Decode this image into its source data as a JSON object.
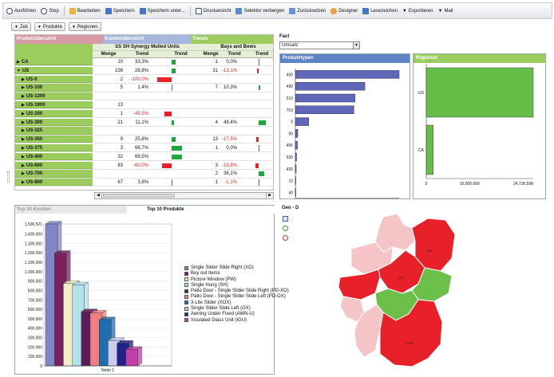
{
  "toolbar": {
    "run": "Ausführen",
    "stop": "Stop",
    "edit": "Bearbeiten",
    "save": "Speichern",
    "save_as": "Speichern unter...",
    "print": "Druckansicht",
    "hide_selector": "Selektor verbergen",
    "reset": "Zurücksetzen",
    "designer": "Designer",
    "bookmarks": "Lesezeichen",
    "export": "Exportieren",
    "mail": "Mail"
  },
  "dims": {
    "time": "Zeit",
    "products": "Produkte",
    "regions": "Regionen"
  },
  "grid": {
    "h_products": "Produktübersicht",
    "h_customers": "Kundenübersicht",
    "h_trends": "Trends",
    "g1": "SS SH Synergy Mulled Units",
    "g2": "Bays and Bows",
    "col_qty": "Menge",
    "col_trend": "Trend",
    "col_trend2": "Trend",
    "col_qty2": "Menge",
    "col_trend3": "Trend",
    "col_trend4": "Trend",
    "rows": [
      {
        "label": "CA",
        "lvl": 0,
        "arrow": "▶",
        "m1": "10",
        "t1": "33,3%",
        "b1": {
          "c": "g",
          "w": 5
        },
        "m2": "1",
        "t2": "0,0%",
        "b2": {
          "c": "t",
          "w": 1
        }
      },
      {
        "label": "US",
        "lvl": 0,
        "arrow": "▼",
        "m1": "236",
        "t1": "28,8%",
        "b1": {
          "c": "g",
          "w": 5
        },
        "m2": "31",
        "t2": "-13,1%",
        "b2": {
          "c": "r",
          "w": 2
        }
      },
      {
        "label": "US-0",
        "lvl": 1,
        "arrow": "▶",
        "m1": "2",
        "t1": "-100,0%",
        "b1": {
          "c": "r",
          "w": 18
        },
        "m2": "",
        "t2": "",
        "b2": null
      },
      {
        "label": "US-100",
        "lvl": 1,
        "arrow": "▶",
        "m1": "5",
        "t1": "1,4%",
        "b1": {
          "c": "t",
          "w": 1
        },
        "m2": "7",
        "t2": "10,3%",
        "b2": {
          "c": "g",
          "w": 2
        }
      },
      {
        "label": "US-1300",
        "lvl": 1,
        "arrow": "▶",
        "m1": "",
        "t1": "",
        "b1": null,
        "m2": "",
        "t2": "",
        "b2": null
      },
      {
        "label": "US-1900",
        "lvl": 1,
        "arrow": "▶",
        "m1": "13",
        "t1": "",
        "b1": null,
        "m2": "",
        "t2": "",
        "b2": null
      },
      {
        "label": "US-200",
        "lvl": 1,
        "arrow": "▶",
        "m1": "1",
        "t1": "-45,5%",
        "b1": {
          "c": "r",
          "w": 9
        },
        "m2": "",
        "t2": "",
        "b2": null
      },
      {
        "label": "US-300",
        "lvl": 1,
        "arrow": "▶",
        "m1": "21",
        "t1": "11,1%",
        "b1": {
          "c": "g",
          "w": 3
        },
        "m2": "4",
        "t2": "48,4%",
        "b2": {
          "c": "g",
          "w": 9
        }
      },
      {
        "label": "US-325",
        "lvl": 1,
        "arrow": "▶",
        "m1": "",
        "t1": "",
        "b1": null,
        "m2": "",
        "t2": "",
        "b2": null
      },
      {
        "label": "US-350",
        "lvl": 1,
        "arrow": "▶",
        "m1": "9",
        "t1": "25,8%",
        "b1": {
          "c": "g",
          "w": 5
        },
        "m2": "13",
        "t2": "-17,5%",
        "b2": {
          "c": "r",
          "w": 3
        }
      },
      {
        "label": "US-375",
        "lvl": 1,
        "arrow": "▶",
        "m1": "3",
        "t1": "66,7%",
        "b1": {
          "c": "g",
          "w": 13
        },
        "m2": "1",
        "t2": "0,0%",
        "b2": {
          "c": "t",
          "w": 1
        }
      },
      {
        "label": "US-400",
        "lvl": 1,
        "arrow": "▶",
        "m1": "32",
        "t1": "69,5%",
        "b1": {
          "c": "g",
          "w": 13
        },
        "m2": "",
        "t2": "",
        "b2": null
      },
      {
        "label": "US-600",
        "lvl": 1,
        "arrow": "▶",
        "m1": "83",
        "t1": "-60,0%",
        "b1": {
          "c": "r",
          "w": 12
        },
        "m2": "3",
        "t2": "-19,8%",
        "b2": {
          "c": "r",
          "w": 4
        }
      },
      {
        "label": "US-700",
        "lvl": 1,
        "arrow": "▶",
        "m1": "",
        "t1": "",
        "b1": null,
        "m2": "2",
        "t2": "36,1%",
        "b2": {
          "c": "g",
          "w": 7
        }
      },
      {
        "label": "US-800",
        "lvl": 1,
        "arrow": "▶",
        "m1": "67",
        "t1": "3,8%",
        "b1": {
          "c": "t",
          "w": 1
        },
        "m2": "1",
        "t2": "-1,1%",
        "b2": {
          "c": "t",
          "w": 1
        }
      }
    ]
  },
  "fact": {
    "label": "Fact",
    "value": "Umsatz"
  },
  "producttypes": {
    "title": "Produkttypen",
    "cats": [
      "430",
      "490",
      "510",
      "703",
      "0",
      "50",
      "495",
      "530",
      "435",
      "10",
      "40"
    ],
    "values": [
      8507577,
      5700000,
      4900000,
      4800000,
      1100000,
      200000,
      170000,
      100000,
      70000,
      30000,
      20000
    ],
    "ticks": [
      "0",
      "2,500,000",
      "5,000,000",
      "8,507,577"
    ],
    "max": 8507577
  },
  "regions": {
    "title": "Regionen",
    "cats": [
      "US",
      "CA"
    ],
    "values": [
      24736598,
      1600000
    ],
    "ticks": [
      "0",
      "10,000,000",
      "24,736,598"
    ],
    "max": 24736598
  },
  "bottom": {
    "tab1": "Top 10 Kunden",
    "tab2": "Top 10 Produkte",
    "xlabel": "Netto 1",
    "yticks": [
      "1.506.521",
      "1.400.000",
      "1.300.000",
      "1.200.000",
      "1.100.000",
      "1.000.000",
      "900.000",
      "800.000",
      "700.000",
      "600.000",
      "500.000",
      "400.000",
      "300.000",
      "200.000",
      "100.000",
      "0"
    ]
  },
  "chart_data": [
    {
      "type": "bar",
      "title": "Produkttypen",
      "categories": [
        "430",
        "490",
        "510",
        "703",
        "0",
        "50",
        "495",
        "530",
        "435",
        "10",
        "40"
      ],
      "values": [
        8507577,
        5700000,
        4900000,
        4800000,
        1100000,
        200000,
        170000,
        100000,
        70000,
        30000,
        20000
      ],
      "xlim": [
        0,
        8507577
      ]
    },
    {
      "type": "bar",
      "title": "Regionen",
      "categories": [
        "US",
        "CA"
      ],
      "values": [
        24736598,
        1600000
      ],
      "xlim": [
        0,
        24736598
      ]
    },
    {
      "type": "bar",
      "title": "Top 10 Produkte",
      "xlabel": "Netto 1",
      "ylim": [
        0,
        1506521
      ],
      "series": [
        {
          "name": "Single Slider Slide Right (XO)",
          "values": [
            1506521
          ],
          "color": "#8085c8"
        },
        {
          "name": "Buy out Items",
          "values": [
            1195000
          ],
          "color": "#7a2260"
        },
        {
          "name": "Picture Window (PW)",
          "values": [
            875000
          ],
          "color": "#f4f0c6"
        },
        {
          "name": "Single Hung (SH)",
          "values": [
            860000
          ],
          "color": "#b2e3ea"
        },
        {
          "name": "Patio Door - Single Slider Slide Right (PD-XO)",
          "values": [
            575000
          ],
          "color": "#5b1c5c"
        },
        {
          "name": "Patio Door - Single Slider Slide Left (PD-OX)",
          "values": [
            560000
          ],
          "color": "#f08080"
        },
        {
          "name": "3-Lite Slider (XOX)",
          "values": [
            490000
          ],
          "color": "#1f6fae"
        },
        {
          "name": "Single Slider Slide Left (OX)",
          "values": [
            270000
          ],
          "color": "#ccccef"
        },
        {
          "name": "Awning Under Fixed (AWN-U)",
          "values": [
            240000
          ],
          "color": "#222288"
        },
        {
          "name": "Insulated Glass Unit (IGU)",
          "values": [
            175000
          ],
          "color": "#c040a8"
        }
      ]
    }
  ],
  "geo": {
    "title": "Geo - D",
    "labels": [
      "196",
      "373",
      "2.987"
    ]
  }
}
